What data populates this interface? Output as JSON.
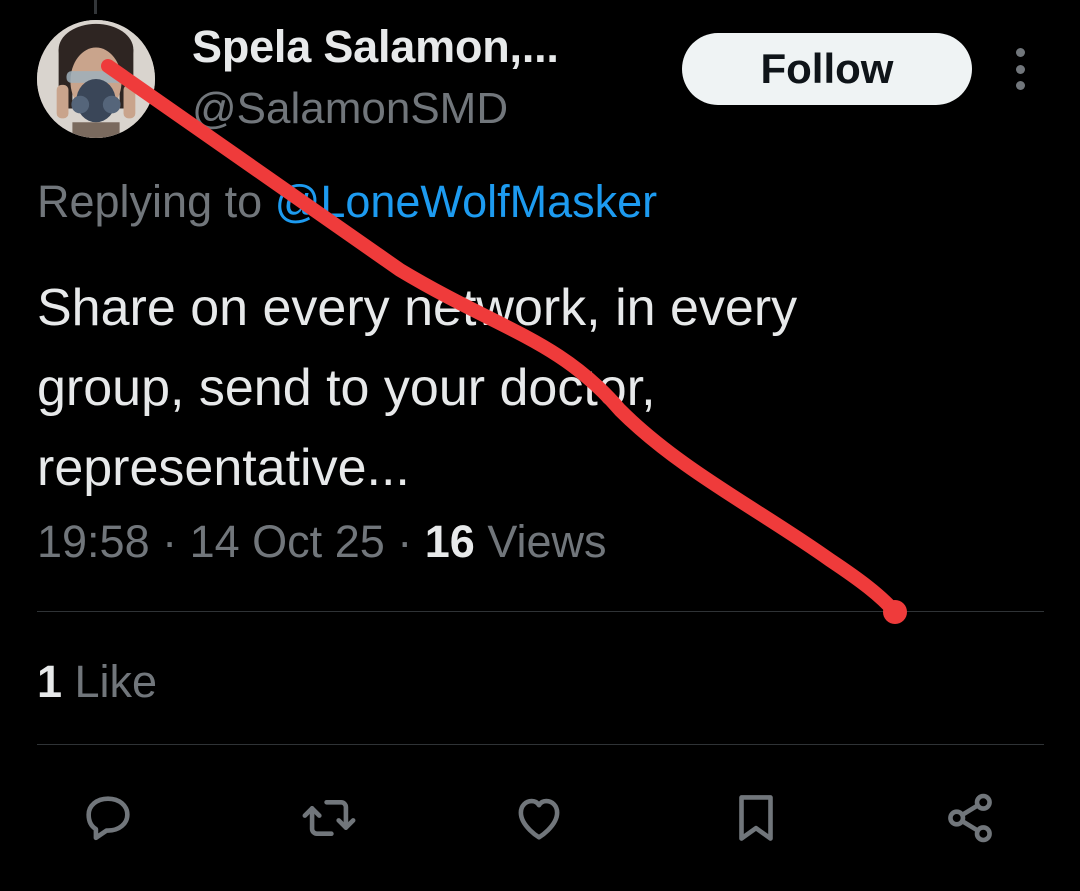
{
  "author": {
    "display_name": "Spela Salamon,...",
    "handle": "@SalamonSMD"
  },
  "follow_label": "Follow",
  "reply_context": {
    "prefix": "Replying to ",
    "mention": "@LoneWolfMasker"
  },
  "tweet": {
    "lines": [
      "Share on every network, in every",
      "group, send to your doctor,",
      "representative..."
    ]
  },
  "meta": {
    "time": "19:58",
    "separator": " · ",
    "date": "14 Oct 25",
    "views_count": "16",
    "views_label": " Views"
  },
  "engagement": {
    "likes_count": "1",
    "likes_label": " Like"
  },
  "actions": [
    "reply-icon",
    "retweet-icon",
    "like-icon",
    "bookmark-icon",
    "share-icon"
  ],
  "colors": {
    "background": "#000000",
    "accent": "#1d9bf0",
    "muted": "#71767b",
    "text": "#e7e9ea",
    "annotation": "#ef3b3b"
  }
}
